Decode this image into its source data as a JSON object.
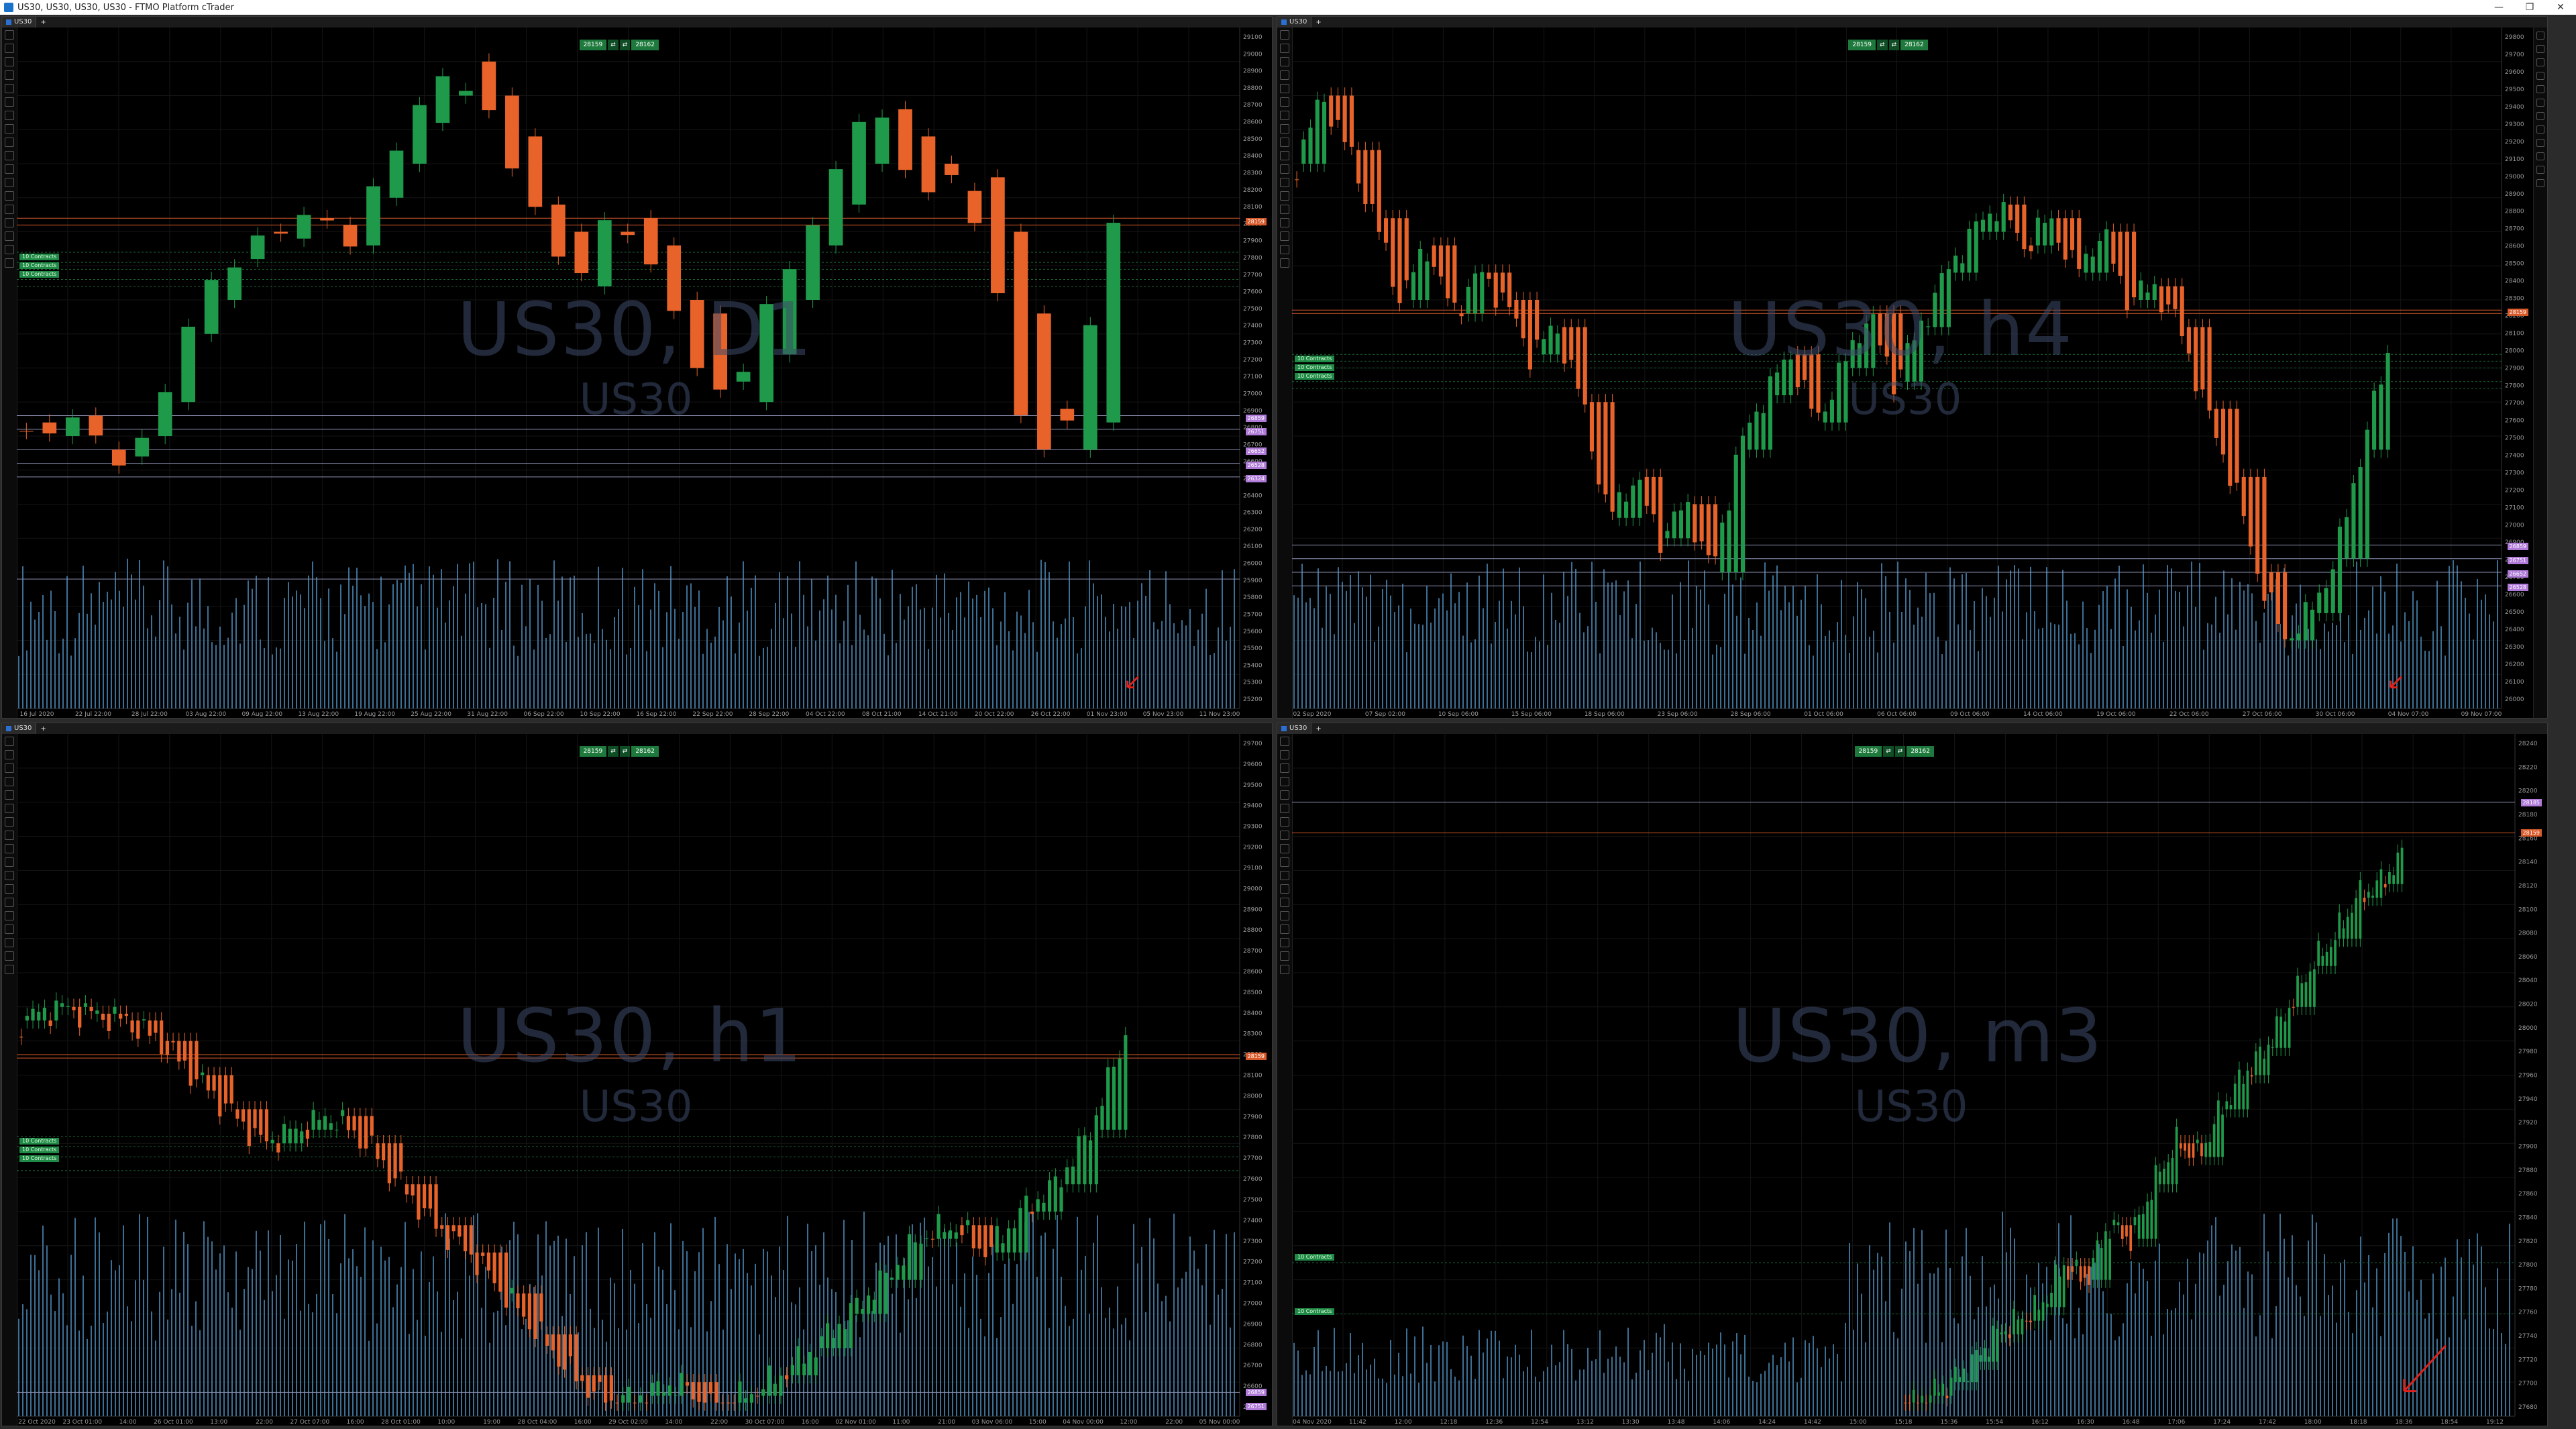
{
  "window": {
    "title": "US30, US30, US30, US30 - FTMO Platform cTrader",
    "minimize": "—",
    "maximize": "❐",
    "close": "✕"
  },
  "colors": {
    "bull": "#1f9a4a",
    "bear": "#e8632a",
    "volume": "#3d6f95",
    "grid": "#1a1a1a",
    "pink_label": "#b07ad8",
    "orange_line": "#d85a2a"
  },
  "panels": [
    {
      "id": "d1",
      "tab_label": "US30",
      "watermark": "US30, D1",
      "watermark_sub": "US30",
      "trade_bid": "28159",
      "trade_ask": "28162",
      "contracts": [
        "10 Contracts",
        "10 Contracts",
        "10 Contracts"
      ],
      "y_ticks": [
        "29100",
        "29000",
        "28900",
        "28800",
        "28700",
        "28600",
        "28500",
        "28400",
        "28300",
        "28200",
        "28100",
        "28000",
        "27900",
        "27800",
        "27700",
        "27600",
        "27500",
        "27400",
        "27300",
        "27200",
        "27100",
        "27000",
        "26900",
        "26800",
        "26700",
        "26600",
        "26500",
        "26400",
        "26300",
        "26200",
        "26100",
        "26000",
        "25900",
        "25800",
        "25700",
        "25600",
        "25500",
        "25400",
        "25300",
        "25200"
      ],
      "x_ticks": [
        "16 Jul 2020",
        "22 Jul 22:00",
        "28 Jul 22:00",
        "03 Aug 22:00",
        "09 Aug 22:00",
        "13 Aug 22:00",
        "19 Aug 22:00",
        "25 Aug 22:00",
        "31 Aug 22:00",
        "06 Sep 22:00",
        "10 Sep 22:00",
        "16 Sep 22:00",
        "22 Sep 22:00",
        "28 Sep 22:00",
        "04 Oct 22:00",
        "08 Oct 21:00",
        "14 Oct 21:00",
        "20 Oct 22:00",
        "26 Oct 22:00",
        "01 Nov 23:00",
        "05 Nov 23:00",
        "11 Nov 23:00"
      ],
      "price_labels": [
        "28159",
        "26859",
        "26751",
        "26652",
        "26528",
        "26324"
      ]
    },
    {
      "id": "h4",
      "tab_label": "US30",
      "watermark": "US30, h4",
      "watermark_sub": "US30",
      "trade_bid": "28159",
      "trade_ask": "28162",
      "contracts": [
        "10 Contracts",
        "10 Contracts",
        "10 Contracts"
      ],
      "y_ticks": [
        "29800",
        "29700",
        "29600",
        "29500",
        "29400",
        "29300",
        "29200",
        "29100",
        "29000",
        "28900",
        "28800",
        "28700",
        "28600",
        "28500",
        "28400",
        "28300",
        "28200",
        "28100",
        "28000",
        "27900",
        "27800",
        "27700",
        "27600",
        "27500",
        "27400",
        "27300",
        "27200",
        "27100",
        "27000",
        "26900",
        "26800",
        "26700",
        "26600",
        "26500",
        "26400",
        "26300",
        "26200",
        "26100",
        "26000"
      ],
      "x_ticks": [
        "02 Sep 2020",
        "07 Sep 02:00",
        "10 Sep 06:00",
        "15 Sep 06:00",
        "18 Sep 06:00",
        "23 Sep 06:00",
        "28 Sep 06:00",
        "01 Oct 06:00",
        "06 Oct 06:00",
        "09 Oct 06:00",
        "14 Oct 06:00",
        "19 Oct 06:00",
        "22 Oct 06:00",
        "27 Oct 06:00",
        "30 Oct 06:00",
        "04 Nov 07:00",
        "09 Nov 07:00"
      ],
      "price_labels": [
        "28159",
        "26859",
        "26751",
        "26652",
        "26528"
      ]
    },
    {
      "id": "h1",
      "tab_label": "US30",
      "watermark": "US30, h1",
      "watermark_sub": "US30",
      "trade_bid": "28159",
      "trade_ask": "28162",
      "contracts": [
        "10 Contracts",
        "10 Contracts",
        "10 Contracts"
      ],
      "y_ticks": [
        "29700",
        "29600",
        "29500",
        "29400",
        "29300",
        "29200",
        "29100",
        "29000",
        "28900",
        "28800",
        "28700",
        "28600",
        "28500",
        "28400",
        "28300",
        "28200",
        "28100",
        "28000",
        "27900",
        "27800",
        "27700",
        "27600",
        "27500",
        "27400",
        "27300",
        "27200",
        "27100",
        "27000",
        "26900",
        "26800",
        "26700",
        "26600",
        "26500"
      ],
      "x_ticks": [
        "22 Oct 2020",
        "23 Oct 01:00",
        "14:00",
        "26 Oct 01:00",
        "13:00",
        "22:00",
        "27 Oct 07:00",
        "16:00",
        "28 Oct 01:00",
        "10:00",
        "19:00",
        "28 Oct 04:00",
        "16:00",
        "29 Oct 02:00",
        "14:00",
        "22:00",
        "30 Oct 07:00",
        "16:00",
        "02 Nov 01:00",
        "11:00",
        "21:00",
        "03 Nov 06:00",
        "15:00",
        "04 Nov 00:00",
        "12:00",
        "22:00",
        "05 Nov 00:00"
      ],
      "price_labels": [
        "28159",
        "26859",
        "26751"
      ]
    },
    {
      "id": "m3",
      "tab_label": "US30",
      "watermark": "US30, m3",
      "watermark_sub": "US30",
      "trade_bid": "28159",
      "trade_ask": "28162",
      "contracts": [
        "10 Contracts",
        "10 Contracts"
      ],
      "y_ticks": [
        "28240",
        "28220",
        "28200",
        "28180",
        "28160",
        "28140",
        "28120",
        "28100",
        "28080",
        "28060",
        "28040",
        "28020",
        "28000",
        "27980",
        "27960",
        "27940",
        "27920",
        "27900",
        "27880",
        "27860",
        "27840",
        "27820",
        "27800",
        "27780",
        "27760",
        "27740",
        "27720",
        "27700",
        "27680"
      ],
      "x_ticks": [
        "04 Nov 2020",
        "11:42",
        "12:00",
        "12:18",
        "12:36",
        "12:54",
        "13:12",
        "13:30",
        "13:48",
        "14:06",
        "14:24",
        "14:42",
        "15:00",
        "15:18",
        "15:36",
        "15:54",
        "16:12",
        "16:30",
        "16:48",
        "17:06",
        "17:24",
        "17:42",
        "18:00",
        "18:18",
        "18:36",
        "18:54",
        "19:12"
      ],
      "price_labels": [
        "28185",
        "28159"
      ]
    }
  ]
}
